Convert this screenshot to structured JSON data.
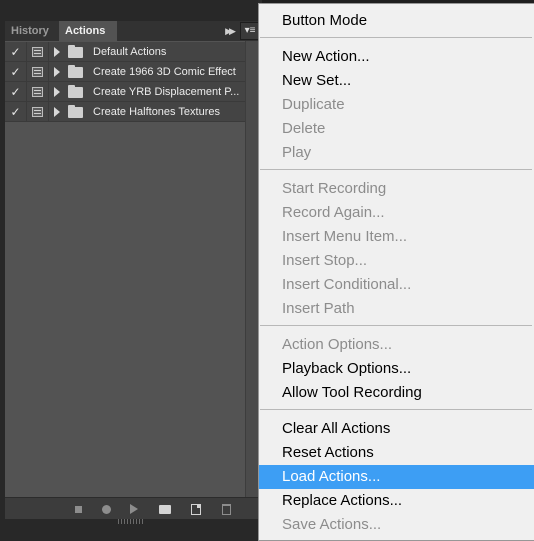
{
  "panel": {
    "tabs": [
      {
        "label": "History",
        "active": false
      },
      {
        "label": "Actions",
        "active": true
      }
    ],
    "forward_icon": "double-chevron-right-icon",
    "menu_icon": "panel-menu-icon",
    "actions": [
      {
        "checked": true,
        "name": "Default Actions"
      },
      {
        "checked": true,
        "name": "Create 1966 3D Comic Effect"
      },
      {
        "checked": true,
        "name": "Create YRB Displacement P..."
      },
      {
        "checked": true,
        "name": "Create Halftones Textures"
      }
    ],
    "check_glyph": "✓",
    "bottom_icons": [
      "stop-icon",
      "record-icon",
      "play-icon",
      "new-set-folder-icon",
      "new-action-icon",
      "trash-icon"
    ]
  },
  "menu": {
    "groups": [
      [
        {
          "label": "Button Mode",
          "enabled": true
        }
      ],
      [
        {
          "label": "New Action...",
          "enabled": true
        },
        {
          "label": "New Set...",
          "enabled": true
        },
        {
          "label": "Duplicate",
          "enabled": false
        },
        {
          "label": "Delete",
          "enabled": false
        },
        {
          "label": "Play",
          "enabled": false
        }
      ],
      [
        {
          "label": "Start Recording",
          "enabled": false
        },
        {
          "label": "Record Again...",
          "enabled": false
        },
        {
          "label": "Insert Menu Item...",
          "enabled": false
        },
        {
          "label": "Insert Stop...",
          "enabled": false
        },
        {
          "label": "Insert Conditional...",
          "enabled": false
        },
        {
          "label": "Insert Path",
          "enabled": false
        }
      ],
      [
        {
          "label": "Action Options...",
          "enabled": false
        },
        {
          "label": "Playback Options...",
          "enabled": true
        },
        {
          "label": "Allow Tool Recording",
          "enabled": true
        }
      ],
      [
        {
          "label": "Clear All Actions",
          "enabled": true
        },
        {
          "label": "Reset Actions",
          "enabled": true
        },
        {
          "label": "Load Actions...",
          "enabled": true,
          "highlighted": true
        },
        {
          "label": "Replace Actions...",
          "enabled": true
        },
        {
          "label": "Save Actions...",
          "enabled": false
        }
      ]
    ]
  },
  "colors": {
    "panel_bg": "#535353",
    "row_bg": "#444444",
    "menu_bg": "#f0f0f0",
    "highlight": "#3d9ef4",
    "disabled_text": "#8c8c8c"
  }
}
